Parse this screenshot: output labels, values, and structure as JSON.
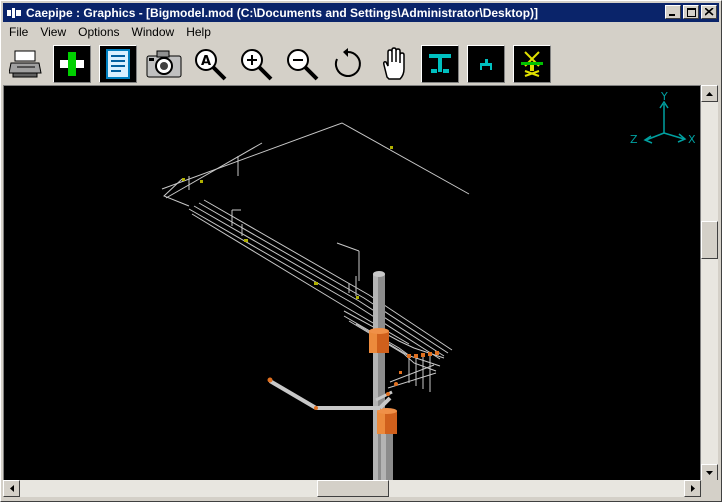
{
  "window": {
    "title": "Caepipe : Graphics - [Bigmodel.mod (C:\\Documents and Settings\\Administrator\\Desktop)]",
    "caption_buttons": [
      "minimize",
      "maximize",
      "close"
    ]
  },
  "menu": [
    {
      "label": "File"
    },
    {
      "label": "View"
    },
    {
      "label": "Options"
    },
    {
      "label": "Window"
    },
    {
      "label": "Help"
    }
  ],
  "toolbar": [
    {
      "name": "print",
      "icon": "printer-icon"
    },
    {
      "name": "add",
      "icon": "plus-icon"
    },
    {
      "name": "text-list",
      "icon": "document-icon"
    },
    {
      "name": "camera",
      "icon": "camera-icon"
    },
    {
      "name": "zoom-window",
      "icon": "zoom-window-icon"
    },
    {
      "name": "zoom-in",
      "icon": "zoom-in-icon"
    },
    {
      "name": "zoom-out",
      "icon": "zoom-out-icon"
    },
    {
      "name": "rotate",
      "icon": "rotate-icon"
    },
    {
      "name": "pan",
      "icon": "hand-icon"
    },
    {
      "name": "show-supports",
      "icon": "supports-icon"
    },
    {
      "name": "show-nodes",
      "icon": "nodes-icon"
    },
    {
      "name": "show-anchors",
      "icon": "anchor-icon"
    }
  ],
  "axes": {
    "y": "Y",
    "z": "Z",
    "x": "X",
    "color": "#00a0a0"
  },
  "colors": {
    "background": "#000000",
    "pipe": "#c8c8c8",
    "vessel": "#e07020",
    "titlebar": "#0a246a"
  }
}
